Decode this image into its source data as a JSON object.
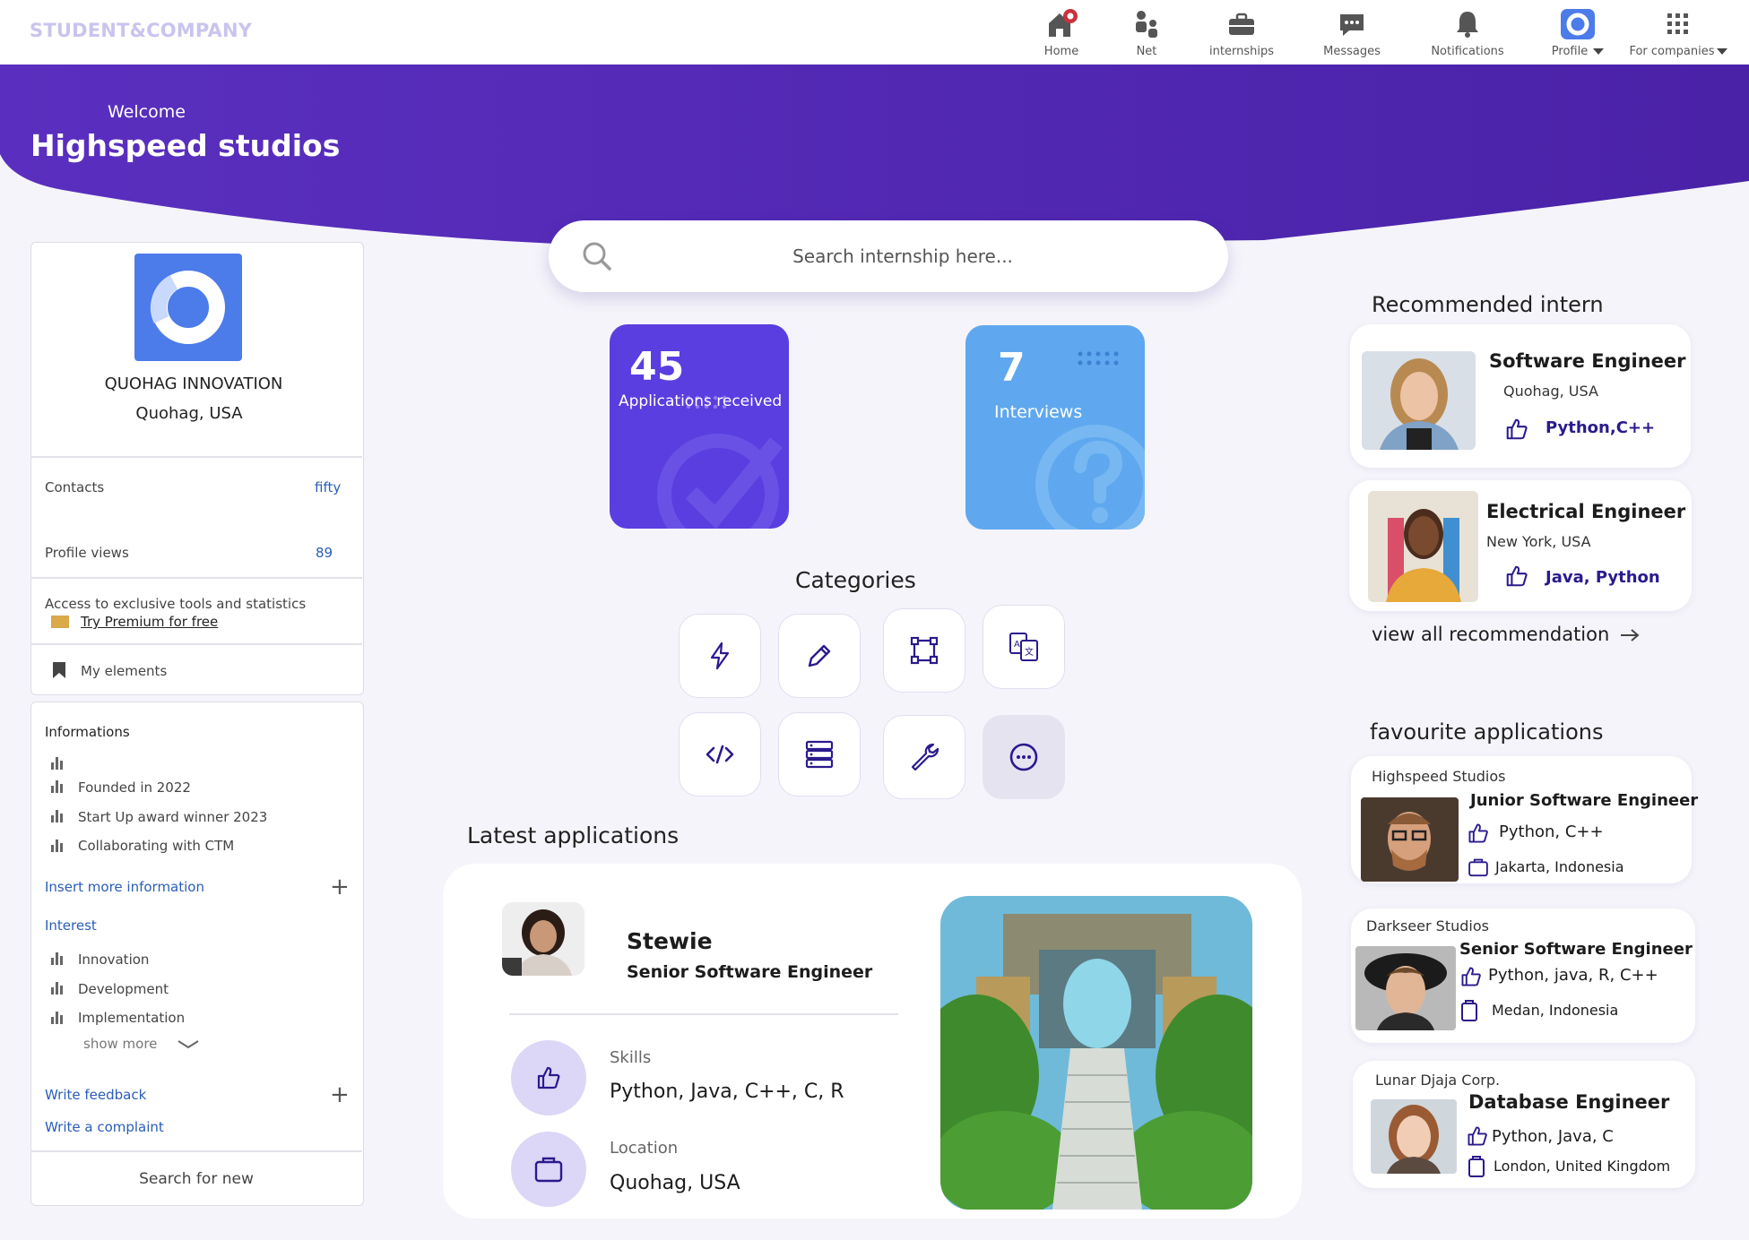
{
  "brand": "STUDENT&COMPANY",
  "nav": {
    "home": "Home",
    "net": "Net",
    "internships": "internships",
    "messages": "Messages",
    "notifications": "Notifications",
    "profile": "Profile",
    "for_companies": "For companies"
  },
  "banner": {
    "welcome": "Welcome",
    "company": "Highspeed studios"
  },
  "search": {
    "placeholder": "Search internship here..."
  },
  "sidebar": {
    "company_name": "QUOHAG INNOVATION",
    "company_location": "Quohag, USA",
    "contacts_label": "Contacts",
    "contacts_value": "fifty",
    "profile_views_label": "Profile views",
    "profile_views_value": "89",
    "premium_text": "Access to exclusive tools and statistics",
    "premium_link": "Try Premium for free",
    "my_elements": "My elements",
    "informations_title": "Informations",
    "info_items": [
      "Founded in 2022",
      "Start Up award winner 2023",
      "Collaborating with CTM"
    ],
    "insert_more": "Insert more information",
    "interest_title": "Interest",
    "interest_items": [
      "Innovation",
      "Development",
      "Implementation"
    ],
    "show_more": "show more",
    "write_feedback": "Write feedback",
    "write_complaint": "Write a complaint",
    "search_new": "Search for new"
  },
  "stats": {
    "applications_count": "45",
    "applications_label": "Applications received",
    "interviews_count": "7",
    "interviews_label": "Interviews"
  },
  "categories_title": "Categories",
  "categories": [
    "lightning-icon",
    "pencil-icon",
    "vector-shape-icon",
    "translate-icon",
    "code-icon",
    "server-icon",
    "wrench-icon",
    "more-icon"
  ],
  "latest": {
    "title": "Latest applications",
    "name": "Stewie",
    "role": "Senior Software Engineer",
    "skills_label": "Skills",
    "skills_value": "Python, Java, C++, C, R",
    "location_label": "Location",
    "location_value": "Quohag, USA"
  },
  "recommended": {
    "title": "Recommended intern",
    "items": [
      {
        "title": "Software Engineer",
        "location": "Quohag, USA",
        "skills": "Python,C++"
      },
      {
        "title": "Electrical Engineer",
        "location": "New York, USA",
        "skills": "Java, Python"
      }
    ],
    "view_all": "view all recommendation"
  },
  "favourites": {
    "title": "favourite applications",
    "items": [
      {
        "company": "Highspeed Studios",
        "title": "Junior Software Engineer",
        "skills": "Python, C++",
        "location": "Jakarta, Indonesia"
      },
      {
        "company": "Darkseer Studios",
        "title": "Senior Software Engineer",
        "skills": "Python, java, R, C++",
        "location": "Medan, Indonesia"
      },
      {
        "company": "Lunar Djaja Corp.",
        "title": "Database Engineer",
        "skills": "Python, Java, C",
        "location": "London, United Kingdom"
      }
    ]
  },
  "colors": {
    "banner_start": "#5a2fbf",
    "banner_end": "#4a22a8",
    "applications_card": "#5a3ee0",
    "interviews_card": "#5fa8ef",
    "accent": "#2a1a8e",
    "link": "#2a5db8"
  }
}
